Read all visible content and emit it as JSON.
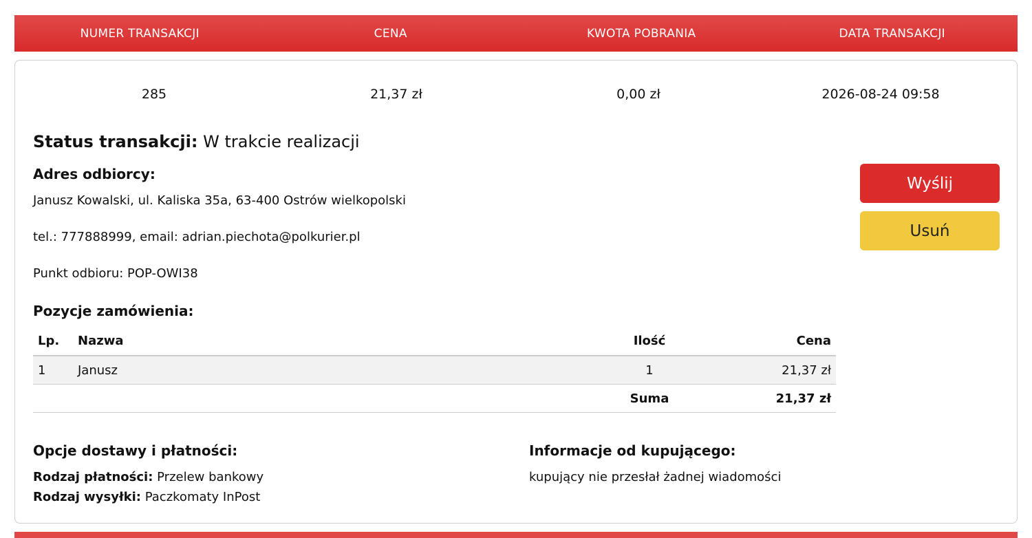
{
  "header": {
    "columns": [
      "NUMER TRANSAKCJI",
      "CENA",
      "KWOTA POBRANIA",
      "DATA TRANSAKCJI"
    ]
  },
  "transaction": {
    "number": "285",
    "price": "21,37 zł",
    "cod_amount": "0,00 zł",
    "date": "2026-08-24 09:58",
    "status_label": "Status transakcji:",
    "status_value": " W trakcie realizacji"
  },
  "recipient": {
    "title": "Adres odbiorcy:",
    "address": "Janusz Kowalski, ul. Kaliska 35a, 63-400 Ostrów wielkopolski",
    "contact": "tel.: 777888999, email: adrian.piechota@polkurier.pl",
    "pickup_point": "Punkt odbioru: POP-OWI38"
  },
  "actions": {
    "send_label": "Wyślij",
    "delete_label": "Usuń"
  },
  "order_items": {
    "title": "Pozycje zamówienia:",
    "headers": {
      "lp": "Lp.",
      "name": "Nazwa",
      "qty": "Ilość",
      "price": "Cena"
    },
    "rows": [
      {
        "lp": "1",
        "name": "Janusz",
        "qty": "1",
        "price": "21,37 zł"
      }
    ],
    "sum_label": "Suma",
    "sum_value": "21,37 zł"
  },
  "delivery": {
    "title": "Opcje dostawy i płatności:",
    "payment_label": "Rodzaj płatności:",
    "payment_value": " Przelew bankowy",
    "shipping_label": "Rodzaj wysyłki:",
    "shipping_value": " Paczkomaty InPost"
  },
  "buyer_info": {
    "title": "Informacje od kupującego:",
    "message": "kupujący nie przesłał żadnej wiadomości"
  },
  "colors": {
    "header_red": "#dc2b2b",
    "send_button": "#dc2b2b",
    "delete_button": "#f0c93e"
  }
}
